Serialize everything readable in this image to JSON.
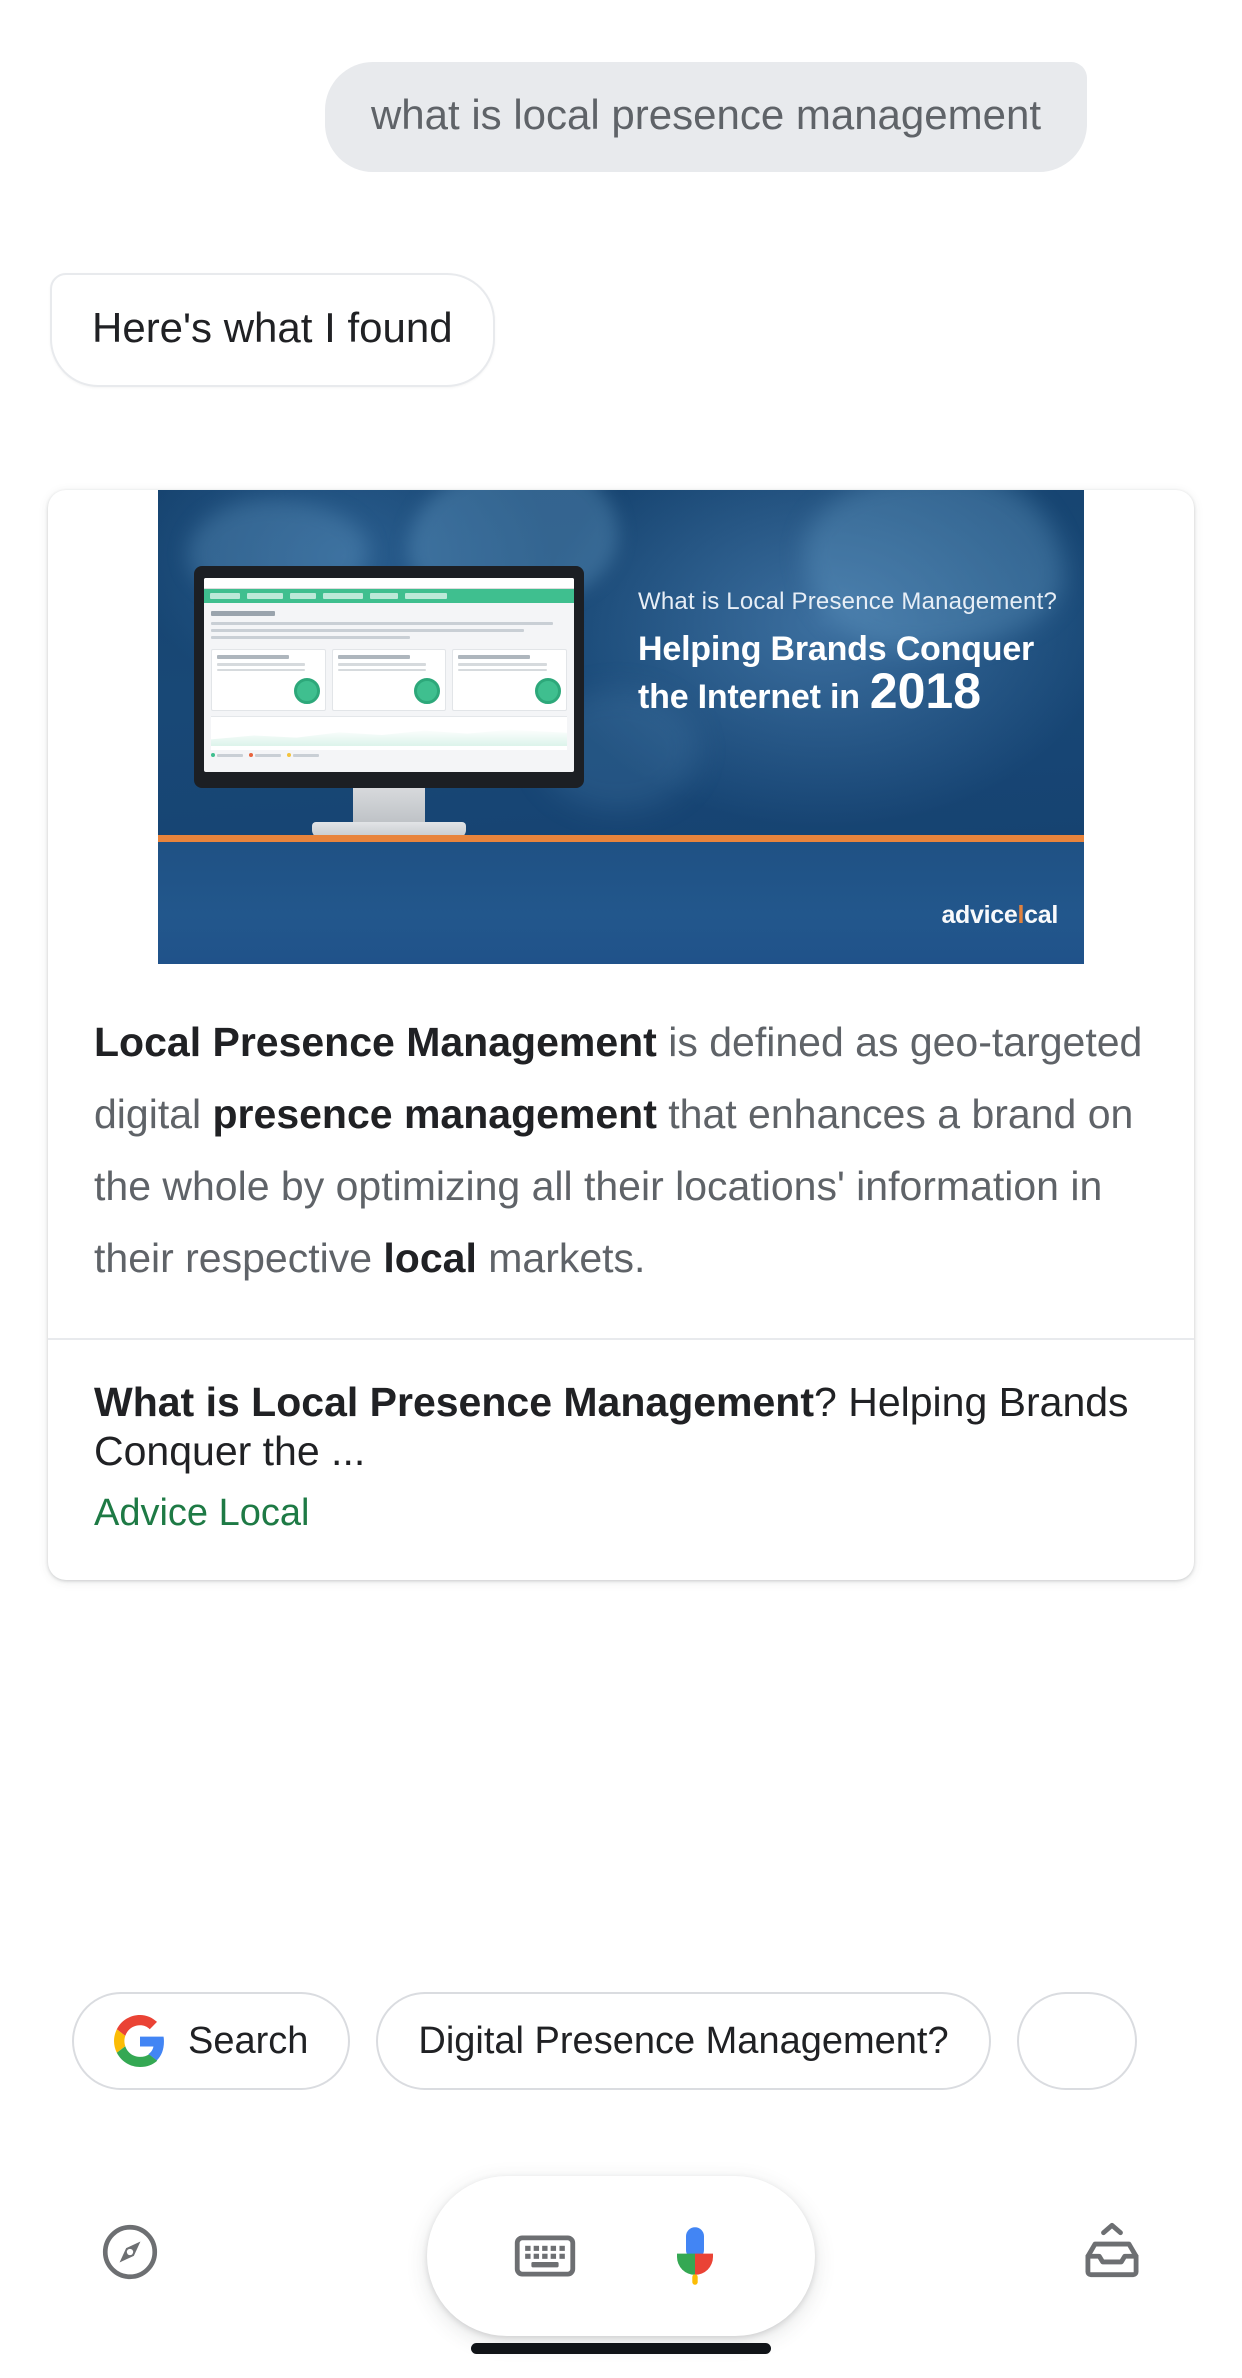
{
  "conversation": {
    "user_query": "what is local presence management",
    "assistant_reply": "Here's what I found"
  },
  "card": {
    "banner": {
      "eyebrow": "What is Local Presence Management?",
      "headline_line1": "Helping Brands Conquer",
      "headline_line2": "the Internet in",
      "year": "2018",
      "logo_text": "advice",
      "logo_text2": "cal",
      "logo_dot": "l",
      "accent_color": "#e8843c",
      "background_color": "#16436f"
    },
    "answer": {
      "segments": [
        {
          "text": "Local Presence Management",
          "bold": true
        },
        {
          "text": " is defined as geo-targeted digital ",
          "bold": false
        },
        {
          "text": "presence management",
          "bold": true
        },
        {
          "text": " that enhances a brand on the whole by optimizing all their locations' information in their respective ",
          "bold": false
        },
        {
          "text": "local",
          "bold": true
        },
        {
          "text": " markets.",
          "bold": false
        }
      ]
    },
    "source": {
      "title_bold": "What is Local Presence Management",
      "title_rest": "? Helping Brands Conquer the ...",
      "site_name": "Advice Local",
      "site_color": "#1e7a45"
    }
  },
  "suggestions": {
    "chips": [
      {
        "id": "search",
        "label": "Search",
        "icon": "google-g-icon"
      },
      {
        "id": "digital-presence",
        "label": "Digital Presence Management?",
        "icon": null
      },
      {
        "id": "partial",
        "label": "",
        "icon": null
      }
    ]
  },
  "bottom_bar": {
    "explore_icon": "compass-icon",
    "keyboard_icon": "keyboard-icon",
    "mic_icon": "google-mic-icon",
    "updates_icon": "inbox-updates-icon"
  },
  "colors": {
    "user_bubble_bg": "#e8eaed",
    "user_bubble_text": "#5f6368",
    "assistant_text": "#202124",
    "body_text": "#5f6368",
    "card_border": "#e8eaed",
    "google_blue": "#4285f4",
    "google_red": "#ea4335",
    "google_yellow": "#fbbc05",
    "google_green": "#34a853"
  }
}
